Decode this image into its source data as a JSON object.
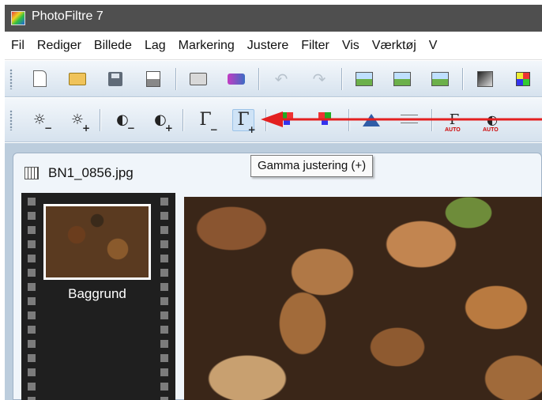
{
  "window": {
    "title": "PhotoFiltre 7",
    "icon": "photofiltre-app-icon"
  },
  "menu": {
    "items": [
      "Fil",
      "Rediger",
      "Billede",
      "Lag",
      "Markering",
      "Justere",
      "Filter",
      "Vis",
      "Værktøj",
      "V"
    ]
  },
  "toolbar2": {
    "brightness_minus": "☼",
    "brightness_plus": "☼",
    "contrast_minus": "◐",
    "contrast_plus": "◐",
    "gamma_minus": "Γ",
    "gamma_plus": "Γ",
    "auto_gamma": "Γ",
    "auto_label": "AUTO",
    "auto_label2": "AUTO",
    "auto_contrast": "◐",
    "minus": "−",
    "plus": "+"
  },
  "tooltip": {
    "text": "Gamma justering (+)"
  },
  "document": {
    "title": "BN1_0856.jpg",
    "layer_name": "Baggrund"
  },
  "colors": {
    "titlebar": "#4f4f4f",
    "toolbar": "#dbe6f0",
    "workspace": "#bccddd",
    "arrow": "#e32020"
  }
}
